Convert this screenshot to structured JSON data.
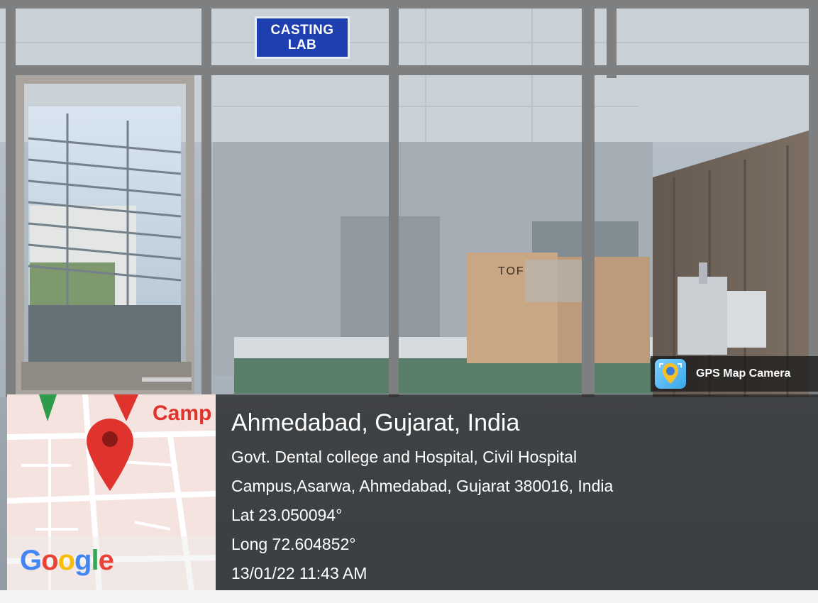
{
  "scene": {
    "sign_text": "CASTING LAB",
    "box_text": "TOF",
    "colors": {
      "sign_blue": "#1e3fb0",
      "map_pin": "#e0332d",
      "overlay": "#1c1c1c"
    }
  },
  "gps_badge": {
    "label": "GPS Map Camera",
    "icon": "map-camera-icon"
  },
  "map": {
    "label": "Camp",
    "brand_letters": [
      {
        "char": "G",
        "color": "#4285F4"
      },
      {
        "char": "o",
        "color": "#EA4335"
      },
      {
        "char": "o",
        "color": "#FBBC05"
      },
      {
        "char": "g",
        "color": "#4285F4"
      },
      {
        "char": "l",
        "color": "#34A853"
      },
      {
        "char": "e",
        "color": "#EA4335"
      }
    ]
  },
  "location": {
    "city": "Ahmedabad, Gujarat, India",
    "address_line1": "Govt. Dental college and Hospital, Civil Hospital",
    "address_line2": "Campus,Asarwa, Ahmedabad, Gujarat 380016, India",
    "lat": "Lat 23.050094°",
    "long": "Long 72.604852°",
    "datetime": "13/01/22 11:43 AM"
  }
}
